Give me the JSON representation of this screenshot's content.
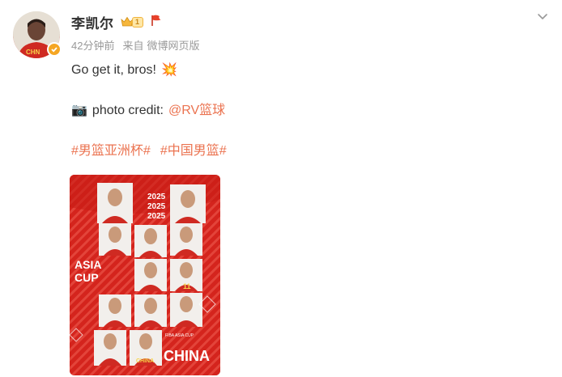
{
  "user": {
    "name": "李凯尔",
    "vip_level": "1",
    "avatar_icon": "avatar-china-jersey",
    "verified_icon": "orange-verified-icon"
  },
  "meta": {
    "time": "42分钟前",
    "source_label": "来自",
    "source": "微博网页版"
  },
  "post": {
    "text_line1": "Go get it, bros!",
    "emoji_line1": "💥",
    "credit_emoji": "📷",
    "credit_prefix": "photo credit:",
    "credit_mention": "@RV篮球",
    "hashtags": [
      "#男篮亚洲杯#",
      "#中国男篮#"
    ]
  },
  "image": {
    "years": [
      "2025",
      "2025",
      "2025"
    ],
    "event_line1": "ASIA",
    "event_line2": "CUP",
    "team": "CHINA",
    "jersey_numbers": [
      "11"
    ],
    "jersey_text": "CHINA",
    "small_caption": "FIBA ASIA CUP"
  },
  "colors": {
    "accent": "#eb7350",
    "poster_red": "#d22a22",
    "muted": "#999999"
  }
}
